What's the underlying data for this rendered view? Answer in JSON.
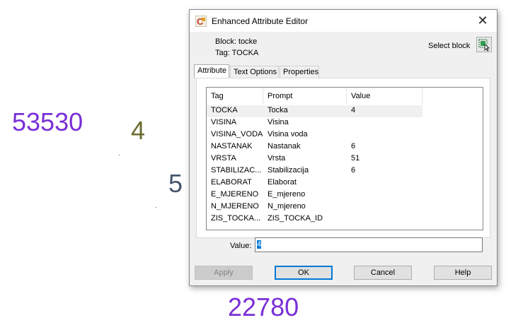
{
  "drawing": {
    "texts": [
      {
        "id": "drawing-text-53530",
        "text": "53530",
        "color": "#7a2fd8"
      },
      {
        "id": "drawing-text-4",
        "text": "4",
        "color": "#6b6b2e"
      },
      {
        "id": "drawing-text-5",
        "text": "5",
        "color": "#46566b"
      },
      {
        "id": "drawing-text-22780",
        "text": "22780",
        "color": "#7a2fd8"
      }
    ]
  },
  "dialog": {
    "title": "Enhanced Attribute Editor",
    "close_glyph": "✕",
    "block_label": "Block: tocke",
    "tag_label": "Tag: TOCKA",
    "select_block_label": "Select block",
    "tabs": [
      {
        "label": "Attribute",
        "active": true
      },
      {
        "label": "Text Options",
        "active": false
      },
      {
        "label": "Properties",
        "active": false
      }
    ],
    "columns": [
      "Tag",
      "Prompt",
      "Value"
    ],
    "rows": [
      {
        "tag": "TOCKA",
        "prompt": "Tocka",
        "value": "4"
      },
      {
        "tag": "VISINA",
        "prompt": "Visina",
        "value": ""
      },
      {
        "tag": "VISINA_VODA",
        "prompt": "Visina voda",
        "value": ""
      },
      {
        "tag": "NASTANAK",
        "prompt": "Nastanak",
        "value": "6"
      },
      {
        "tag": "VRSTA",
        "prompt": "Vrsta",
        "value": "51"
      },
      {
        "tag": "STABILIZAC...",
        "prompt": "Stabilizacija",
        "value": "6"
      },
      {
        "tag": "ELABORAT",
        "prompt": "Elaborat",
        "value": ""
      },
      {
        "tag": "E_MJERENO",
        "prompt": "E_mjereno",
        "value": ""
      },
      {
        "tag": "N_MJERENO",
        "prompt": "N_mjereno",
        "value": ""
      },
      {
        "tag": "ZIS_TOCKA...",
        "prompt": "ZIS_TOCKA_ID",
        "value": ""
      }
    ],
    "value_label": "Value:",
    "value_text": "4",
    "buttons": {
      "apply": "Apply",
      "ok": "OK",
      "cancel": "Cancel",
      "help": "Help"
    },
    "accent_color": "#0078d7"
  }
}
